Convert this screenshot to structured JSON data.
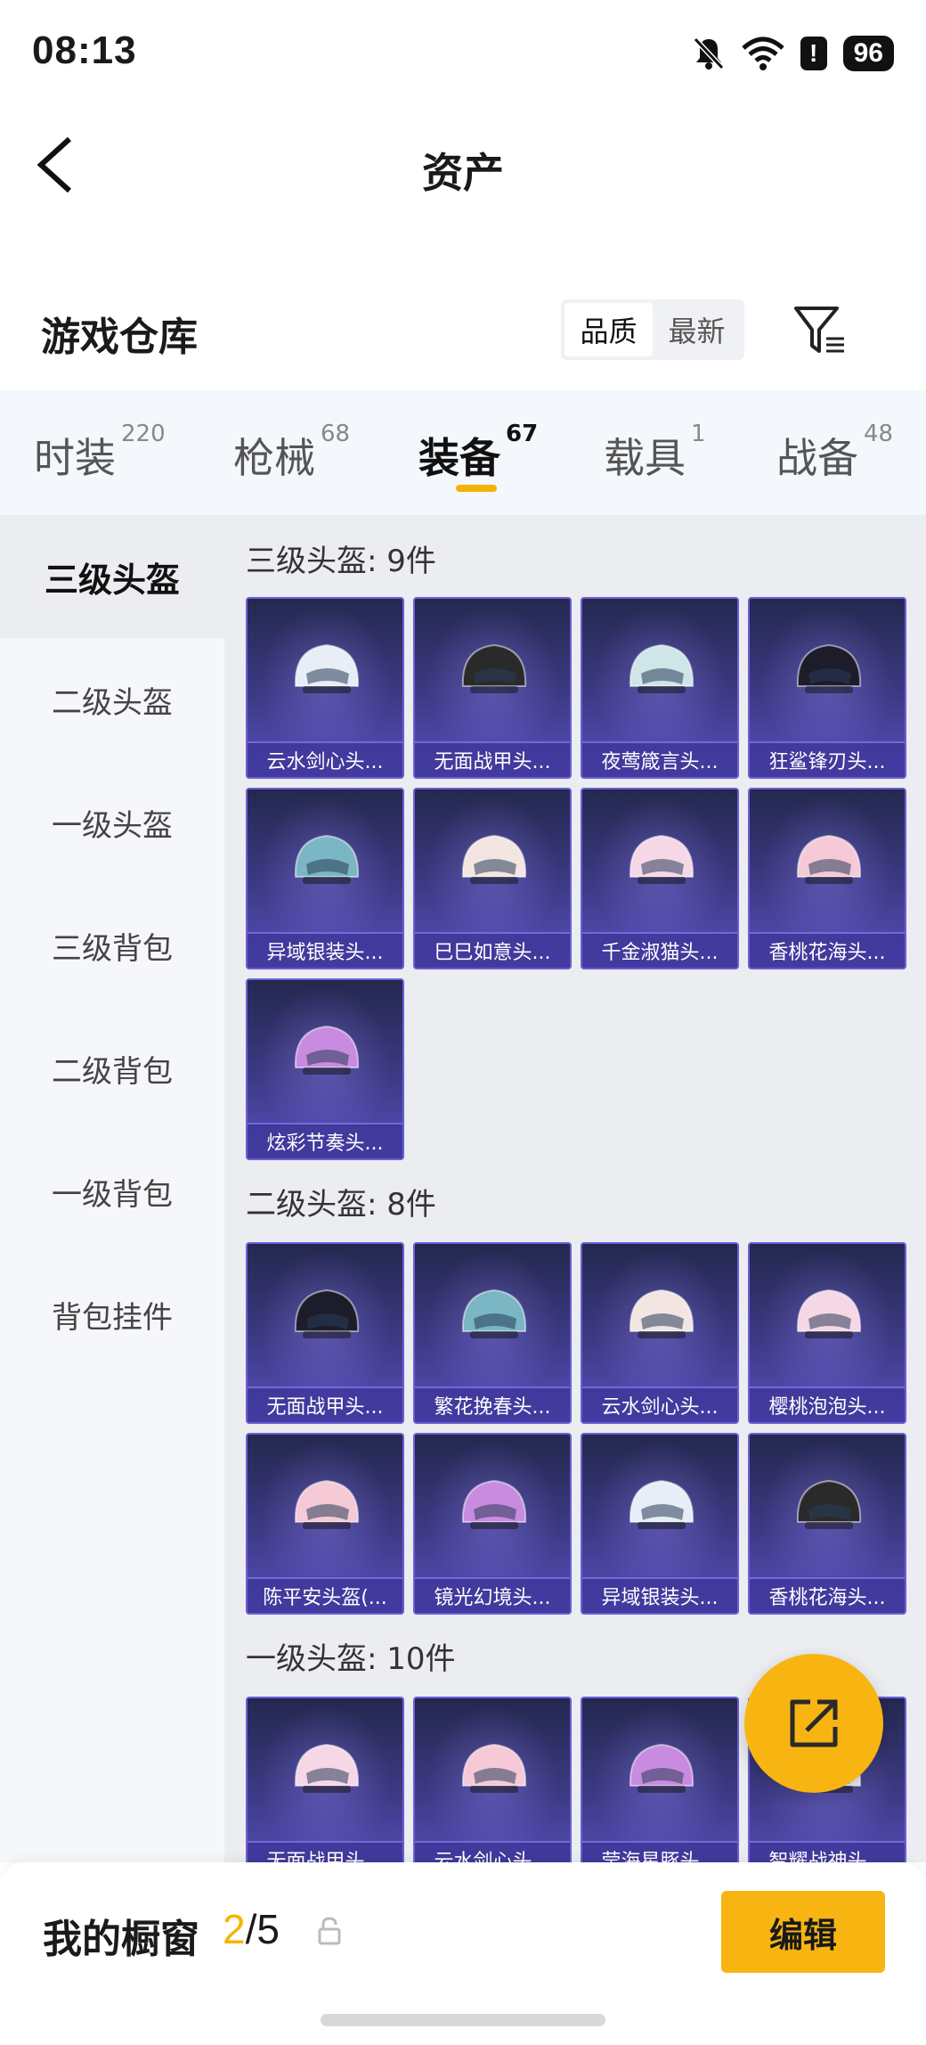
{
  "status": {
    "time": "08:13",
    "battery": "96",
    "alert": "!"
  },
  "header": {
    "title": "资产"
  },
  "warehouse": {
    "title": "游戏仓库",
    "sort_options": [
      "品质",
      "最新"
    ],
    "sort_active": "品质"
  },
  "categories": [
    {
      "label": "时装",
      "count": "220"
    },
    {
      "label": "枪械",
      "count": "68"
    },
    {
      "label": "装备",
      "count": "67",
      "active": true
    },
    {
      "label": "载具",
      "count": "1"
    },
    {
      "label": "战备",
      "count": "48"
    }
  ],
  "sub_categories": [
    "三级头盔",
    "二级头盔",
    "一级头盔",
    "三级背包",
    "二级背包",
    "一级背包",
    "背包挂件"
  ],
  "sections": [
    {
      "title": "三级头盔: 9件",
      "items": [
        "云水剑心头...",
        "无面战甲头...",
        "夜莺箴言头...",
        "狂鲨锋刃头...",
        "异域银装头...",
        "巳巳如意头...",
        "千金淑猫头...",
        "香桃花海头...",
        "炫彩节奏头..."
      ]
    },
    {
      "title": "二级头盔: 8件",
      "items": [
        "无面战甲头...",
        "繁花挽春头...",
        "云水剑心头...",
        "樱桃泡泡头...",
        "陈平安头盔(...",
        "镜光幻境头...",
        "异域银装头...",
        "香桃花海头..."
      ]
    },
    {
      "title": "一级头盔: 10件",
      "items": [
        "无面战甲头...",
        "云水剑心头...",
        "莹海星豚头...",
        "智耀战神头..."
      ]
    }
  ],
  "showcase": {
    "title": "我的橱窗",
    "current": "2",
    "separator": "/",
    "total": "5",
    "edit_label": "编辑"
  },
  "colors": {
    "accent": "#f8b512",
    "card_top": "#24284f",
    "card_bottom": "#5a4fbf"
  },
  "icons": {
    "back": "back-arrow-icon",
    "filter": "filter-icon",
    "share": "share-external-icon",
    "lock": "lock-icon"
  }
}
